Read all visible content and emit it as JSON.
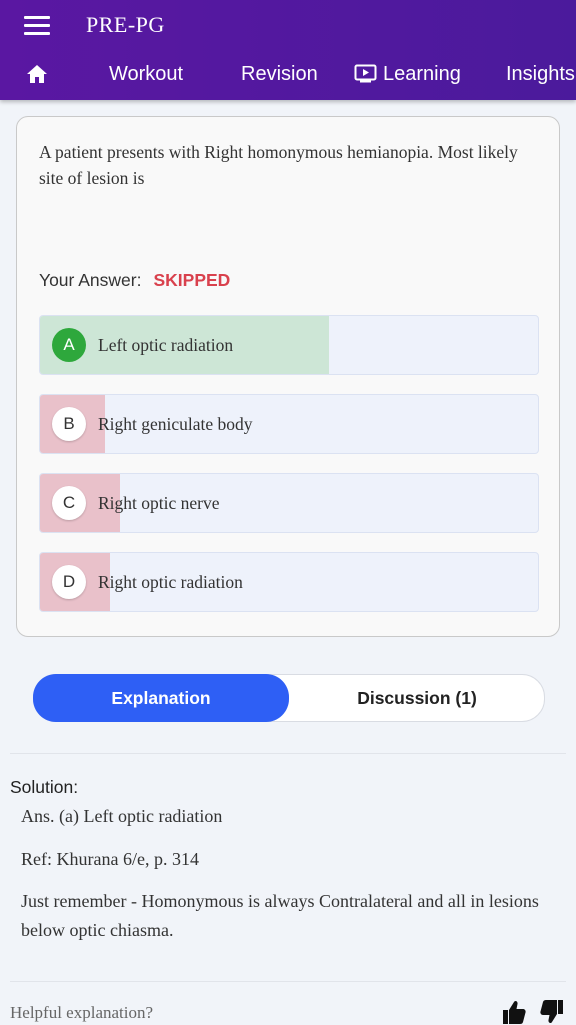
{
  "header": {
    "title": "PRE-PG",
    "nav": [
      {
        "label": "Workout"
      },
      {
        "label": "Revision"
      },
      {
        "label": "Learning"
      },
      {
        "label": "Insights"
      }
    ]
  },
  "question": {
    "text": "A patient presents with Right homonymous hemianopia. Most likely site of lesion is",
    "your_answer_label": "Your Answer:",
    "your_answer_value": "SKIPPED",
    "options": [
      {
        "letter": "A",
        "text": "Left optic radiation",
        "correct": true,
        "fill_fraction": 0.58,
        "fill_color": "#cde6d6"
      },
      {
        "letter": "B",
        "text": "Right geniculate body",
        "correct": false,
        "fill_fraction": 0.13,
        "fill_color": "#e9c1ca"
      },
      {
        "letter": "C",
        "text": "Right optic nerve",
        "correct": false,
        "fill_fraction": 0.16,
        "fill_color": "#e9c1ca"
      },
      {
        "letter": "D",
        "text": "Right optic radiation",
        "correct": false,
        "fill_fraction": 0.14,
        "fill_color": "#e9c1ca"
      }
    ]
  },
  "tabs": {
    "explanation": "Explanation",
    "discussion": "Discussion (1)"
  },
  "solution": {
    "title": "Solution:",
    "answer": "Ans. (a) Left optic radiation",
    "ref": "Ref: Khurana 6/e, p. 314",
    "note": "Just remember - Homonymous is always Contralateral and all in lesions below optic chiasma."
  },
  "feedback": {
    "prompt": "Helpful explanation?"
  },
  "colors": {
    "header": "#5a17a2",
    "accent": "#2e5ff5",
    "correct": "#2ea83c",
    "skipped": "#d9414d"
  }
}
